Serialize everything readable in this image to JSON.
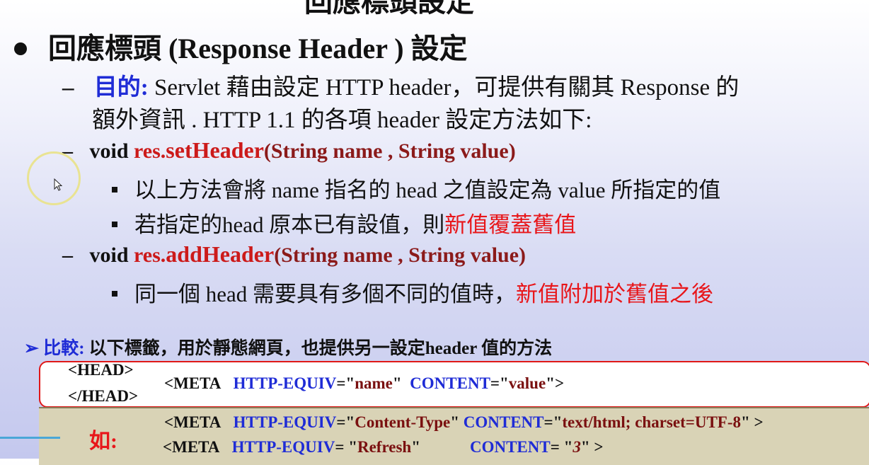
{
  "slide": {
    "cut_title": "回應標頭設定",
    "heading": "回應標頭 (Response Header ) 設定",
    "purpose": {
      "dash": "–",
      "label": "目的:",
      "text_line1": " Servlet 藉由設定 HTTP header，可提供有關其 Response 的",
      "text_line2": "額外資訊 .   HTTP 1.1 的各項 header 設定方法如下:"
    },
    "set_header": {
      "dash": "–",
      "void": "void ",
      "obj": "res.",
      "method": "setHeader",
      "params": "(String name , String value)",
      "bullet1": "以上方法會將 name 指名的 head 之值設定為 value 所指定的值",
      "bullet2_prefix": "若指定的head 原本已有設值，則",
      "bullet2_highlight": "新值覆蓋舊值"
    },
    "add_header": {
      "dash": "–",
      "void": "void ",
      "obj": "res.",
      "method": "addHeader",
      "params": "(String name , String value)",
      "bullet1_prefix": "同一個 head 需要具有多個不同的值時，",
      "bullet1_highlight": "新值附加於舊值之後"
    },
    "compare": {
      "arrow": "➢",
      "label": "比較:",
      "text": " 以下標籤，用於靜態網頁，也提供另一設定header 值的方法"
    },
    "box1": {
      "head_open": "<HEAD>",
      "head_close": "</HEAD>",
      "meta_open": "<META",
      "http_equiv": "HTTP-EQUIV",
      "eq1": "=\"",
      "name_val": "name",
      "q1": "\"",
      "content": "CONTENT",
      "eq2": "=\"",
      "value_val": "value",
      "close": "\">"
    },
    "box2": {
      "label": "如:",
      "line1_meta": "<META",
      "line1_http_equiv": "HTTP-EQUIV",
      "line1_eq": "=\"",
      "line1_name": "Content-Type",
      "line1_q": "\"",
      "line1_content": "CONTENT",
      "line1_eq2": "=\"",
      "line1_value": "text/html; charset=UTF-8",
      "line1_close": "\" >",
      "line2_meta": "<META",
      "line2_http_equiv": "HTTP-EQUIV",
      "line2_eq": "= \"",
      "line2_name": "Refresh",
      "line2_q": "\"",
      "line2_content": "CONTENT",
      "line2_eq2": "= \"",
      "line2_value": "3",
      "line2_close": "\" >"
    }
  }
}
